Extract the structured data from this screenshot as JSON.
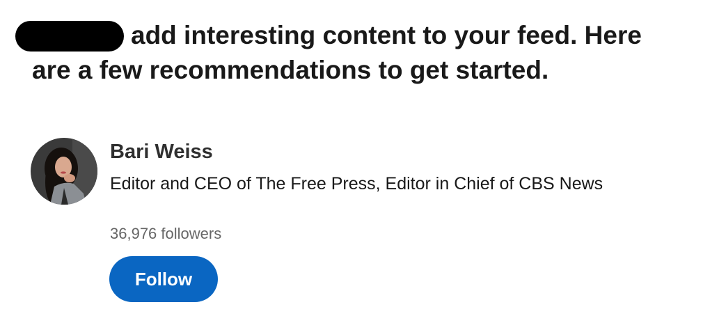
{
  "intro": {
    "text": "add interesting content to your feed. Here are a few recommendations to get started."
  },
  "recommendation": {
    "name": "Bari Weiss",
    "headline": "Editor and CEO of The Free Press, Editor in Chief of CBS News",
    "followers": "36,976 followers",
    "follow_label": "Follow",
    "avatar_icon": "profile-photo",
    "accent_color": "#0a66c2"
  }
}
